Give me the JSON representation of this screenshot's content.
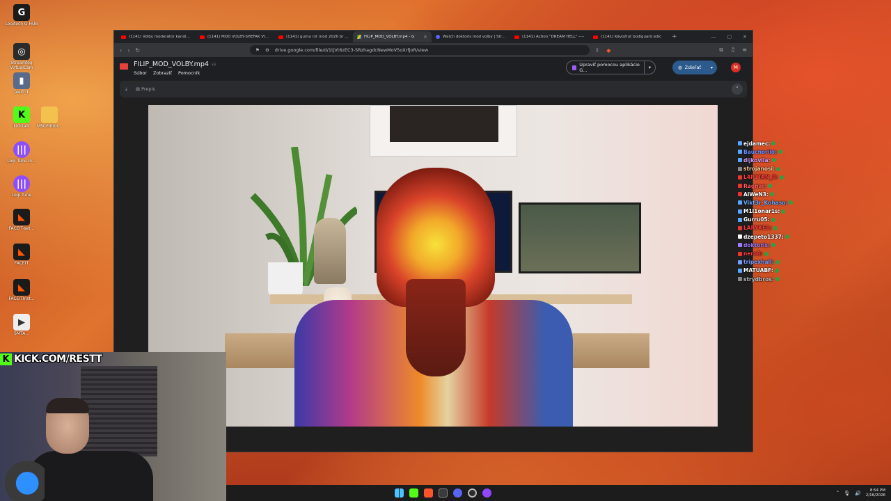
{
  "desktop": {
    "icons": [
      {
        "label": "Logitech G HUB",
        "icon": "g-hub-icon",
        "color": "#1b1b1b"
      },
      {
        "label": "Streamfog VirtualCam",
        "icon": "streamfog-icon",
        "color": "#2b2b2b"
      },
      {
        "label": "alert_1",
        "icon": "file-icon",
        "color": "#5a6a8a"
      },
      {
        "label": "kicktalk",
        "icon": "kick-icon",
        "color": "#53fc18"
      },
      {
        "label": "MSCEditor...",
        "icon": "folder-icon",
        "color": "#f2c14e"
      },
      {
        "label": "Logi Tune In...",
        "icon": "logi-tune-icon",
        "color": "#8e4dff"
      },
      {
        "label": "Logi Tune",
        "icon": "logi-tune-icon",
        "color": "#8e4dff"
      },
      {
        "label": "FACEIT-set...",
        "icon": "faceit-icon",
        "color": "#ff5500"
      },
      {
        "label": "FACEIT",
        "icon": "faceit-icon",
        "color": "#ff5500"
      },
      {
        "label": "FACEITInst...",
        "icon": "faceit-icon",
        "color": "#ff5500"
      },
      {
        "label": "SMTA...",
        "icon": "app-icon",
        "color": "#eeeeee"
      }
    ]
  },
  "browser": {
    "tabs": [
      {
        "title": "(1141) Volby moderátor kandidát",
        "favicon": "youtube",
        "active": false
      },
      {
        "title": "(1141) MOD VOLBY-SHEFAK VIDEI",
        "favicon": "youtube",
        "active": false
      },
      {
        "title": "(1141) gurnu rst mod 2026 br - Yo",
        "favicon": "youtube",
        "active": false
      },
      {
        "title": "FILIP_MOD_VOLBY.mp4 - G",
        "favicon": "drive",
        "active": true
      },
      {
        "title": "Watch doktoris mod volby | Strea",
        "favicon": "discord",
        "active": false
      },
      {
        "title": "(1141) Action \"DREAM HELL\" ----",
        "favicon": "youtube",
        "active": false
      },
      {
        "title": "(1141) Kávožrut bodiguard edic",
        "favicon": "youtube",
        "active": false
      }
    ],
    "new_tab": "+",
    "url": "drive.google.com/file/d/1tjVt6zEC3-SRzhagdcNewMoV5oXrfjoR/view"
  },
  "drive": {
    "filename": "FILIP_MOD_VOLBY.mp4",
    "menus": [
      "Súbor",
      "Zobraziť",
      "Pomocník"
    ],
    "edit_button": "Upraviť pomocou aplikácie G...",
    "share_button": "Zdieľať",
    "avatar_letter": "M",
    "transcript_label": "Prepis"
  },
  "chat": [
    {
      "user": "ejdamec:",
      "color": "#ffffff",
      "badge": "#5aa7ff"
    },
    {
      "user": "Bauchorilo:",
      "color": "#6a8cff",
      "badge": "#5aa7ff"
    },
    {
      "user": "dijkovila:",
      "color": "#d7a0ff",
      "badge": "#5aa7ff"
    },
    {
      "user": "strojanosi:",
      "color": "#ffd0a0",
      "badge": "#888888"
    },
    {
      "user": "L4P1TAN_R:",
      "color": "#ff3b3b",
      "badge": "#e33"
    },
    {
      "user": "Ragnar:",
      "color": "#ff5a5a",
      "badge": "#e33"
    },
    {
      "user": "AiWeN3:",
      "color": "#ffffff",
      "badge": "#e33"
    },
    {
      "user": "Vikt3r_Kohaso:",
      "color": "#6aa8ff",
      "badge": "#5aa7ff"
    },
    {
      "user": "M1l1onar1s:",
      "color": "#ffffff",
      "badge": "#5aa7ff"
    },
    {
      "user": "Gurru05:",
      "color": "#ffffff",
      "badge": "#5aa7ff"
    },
    {
      "user": "LARYKE1:",
      "color": "#ff3b3b",
      "badge": "#e33"
    },
    {
      "user": "dzepeto1337:",
      "color": "#ffffff",
      "badge": "#ffffff"
    },
    {
      "user": "doktoris:",
      "color": "#9f7bff",
      "badge": "#9f7bff"
    },
    {
      "user": "nero8:",
      "color": "#ff3b3b",
      "badge": "#e33"
    },
    {
      "user": "tripexhall:",
      "color": "#7a9cff",
      "badge": "#7a9cff"
    },
    {
      "user": "MATUABF:",
      "color": "#ffffff",
      "badge": "#5aa7ff"
    },
    {
      "user": "strydbros:",
      "color": "#c0c0c0",
      "badge": "#888888"
    }
  ],
  "stream": {
    "kick_banner": "KICK.COM/RESTT"
  },
  "taskbar": {
    "time": "8:54 PM",
    "date": "2/16/2026"
  }
}
